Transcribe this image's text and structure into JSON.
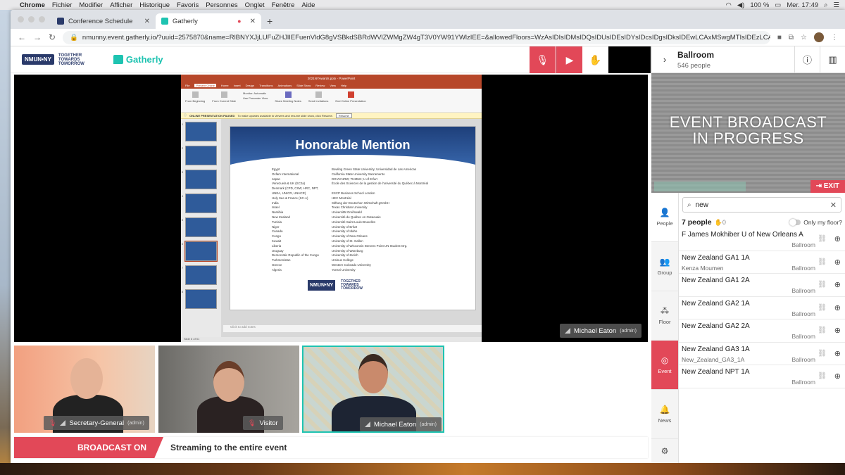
{
  "menubar": {
    "app": "Chrome",
    "items": [
      "Fichier",
      "Modifier",
      "Afficher",
      "Historique",
      "Favoris",
      "Personnes",
      "Onglet",
      "Fenêtre",
      "Aide"
    ],
    "battery": "100 %",
    "clock": "Mer. 17:49"
  },
  "browser": {
    "tabs": [
      {
        "label": "Conference Schedule"
      },
      {
        "label": "Gatherly"
      }
    ],
    "url": "nmunny.event.gatherly.io/?uuid=2575870&name=RlBNYXJjLUFuZHJlIEFuenVldG8gVSBkdSBRdWVlZWMgZW4gT3V0YW91YWlzIEE=&allowedFloors=WzAsIDIsIDMsIDQsIDUsIDEsIDYsIDcsIDgsIDksIDEwLCAxMSwgMTIsIDEzLCAxNCwgMTUsID..."
  },
  "header": {
    "org_logo": "NMUN•NY",
    "org_tagline": "TOGETHER TOWARDS TOMORROW",
    "app_name": "Gatherly"
  },
  "presentation": {
    "window_title": "2021NYAwards.pptx - PowerPoint",
    "ribbon_tabs": [
      "File",
      "Present Online",
      "Home",
      "Insert",
      "Design",
      "Transitions",
      "Animations",
      "Slide Show",
      "Review",
      "View",
      "Help"
    ],
    "active_ribbon_tab": "Present Online",
    "ribbon_groups": [
      "From Beginning",
      "From Current Slide",
      "Monitor: Automatic",
      "Use Presenter View",
      "Share Meeting Notes",
      "Send Invitations",
      "End Online Presentation"
    ],
    "notice": "ONLINE PRESENTATION PAUSED",
    "notice_detail": "To make updates available to viewers and resume slide show, click Resume.",
    "resume_button": "Resume",
    "slide_title": "Honorable Mention",
    "awards": [
      [
        "Egypt",
        "Bowling Green State University; Universidad de Las Americas"
      ],
      [
        "Oxfam International",
        "California State University Sacramento"
      ],
      [
        "Japan",
        "DGVN NRW; THMUN; U of Erfurt"
      ],
      [
        "Venezuela & UK (SC2a)",
        "École des Sciences de la gestion de l'université du Québec à Montréal"
      ],
      [
        "Denmark (CPD, CSW, HRC, NPT,",
        ""
      ],
      [
        "  UNEA, UNICR, UNHCR)",
        "ESCP Business School London"
      ],
      [
        "Holy See & France (SC-A)",
        "HEC Montréal"
      ],
      [
        "India",
        "Stiftung der Deutschen Wirtschaft gGmbH"
      ],
      [
        "Israel",
        "Texas Christian University"
      ],
      [
        "Namibia",
        "Universität Greifswald"
      ],
      [
        "New Zealand",
        "Université du Québec en Outaouais"
      ],
      [
        "Tunisia",
        "Université Saint-Louis-Bruxelles"
      ],
      [
        "Niger",
        "University of Erfurt"
      ],
      [
        "Canada",
        "University of Idaho"
      ],
      [
        "Congo",
        "University of New Orleans"
      ],
      [
        "Kuwait",
        "University of St. Gallen"
      ],
      [
        "Liberia",
        "University of Wisconsin Stevens Point UN Student Org."
      ],
      [
        "Uruguay",
        "University of Würzburg"
      ],
      [
        "Democratic Republic of the Congo",
        "University of Zurich"
      ],
      [
        "Turkmenistan",
        "Ursinus College"
      ],
      [
        "Greece",
        "Western Colorado University"
      ],
      [
        "Algeria",
        "Yonsei University"
      ]
    ],
    "slide_logo_left": "NMUN•NY",
    "slide_logo_right": "TOGETHER TOWARDS TOMORROW",
    "notes_placeholder": "Click to add notes",
    "status_text": "Slide 6 of 51",
    "thumb_numbers": [
      "1",
      "2",
      "3",
      "4",
      "5",
      "6",
      "7",
      "8"
    ]
  },
  "presenter_tag": {
    "name": "Michael Eaton",
    "role": "(admin)"
  },
  "video_tiles": [
    {
      "name": "Secretary-General",
      "role": "(admin)"
    },
    {
      "name": "Visitor",
      "role": ""
    },
    {
      "name": "Michael Eaton",
      "role": "(admin)"
    }
  ],
  "broadcast_bar": {
    "status": "BROADCAST ON",
    "text": "Streaming to the entire event"
  },
  "room": {
    "name": "Ballroom",
    "count": "546 people"
  },
  "broadcast_banner": {
    "line1": "EVENT BROADCAST",
    "line2": "IN PROGRESS",
    "exit": "EXIT"
  },
  "sidebar": [
    {
      "label": "People",
      "icon": "person-icon"
    },
    {
      "label": "Group",
      "icon": "group-icon"
    },
    {
      "label": "Floor",
      "icon": "floor-icon"
    },
    {
      "label": "Event",
      "icon": "globe-icon"
    },
    {
      "label": "News",
      "icon": "bell-icon"
    },
    {
      "label": "",
      "icon": "gear-icon"
    }
  ],
  "people": {
    "search_value": "new",
    "count_label": "7 people",
    "hands": "0",
    "only_my_floor": "Only my floor?",
    "rows": [
      {
        "name": "F James Mokhiber U of New Orleans A",
        "sub": "",
        "location": "Ballroom"
      },
      {
        "name": "New Zealand GA1 1A",
        "sub": "Kenza Moumen",
        "location": "Ballroom"
      },
      {
        "name": "New Zealand GA1 2A",
        "sub": "",
        "location": "Ballroom"
      },
      {
        "name": "New Zealand GA2 1A",
        "sub": "",
        "location": "Ballroom"
      },
      {
        "name": "New Zealand GA2 2A",
        "sub": "",
        "location": "Ballroom"
      },
      {
        "name": "New Zealand GA3 1A",
        "sub": "New_Zealand_GA3_1A",
        "location": "Ballroom"
      },
      {
        "name": "New Zealand NPT 1A",
        "sub": "",
        "location": "Ballroom"
      }
    ]
  },
  "colors": {
    "accent": "#e24858",
    "brand": "#1ec3b1",
    "ppt": "#b7472a"
  }
}
